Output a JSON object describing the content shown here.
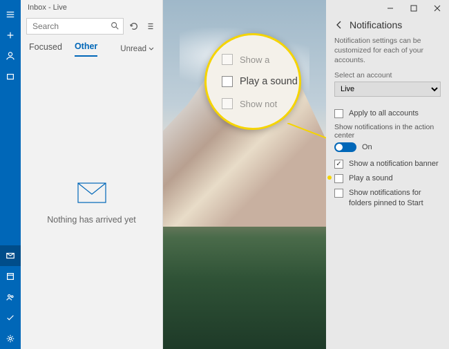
{
  "titlebar": "Inbox - Live",
  "search": {
    "placeholder": "Search"
  },
  "tabs": {
    "focused": "Focused",
    "other": "Other",
    "unread": "Unread"
  },
  "empty_state": "Nothing has arrived yet",
  "lens": {
    "row_top": "Show a",
    "row_main": "Play a sound",
    "row_bottom": "Show not"
  },
  "panel": {
    "title": "Notifications",
    "desc": "Notification settings can be customized for each of your accounts.",
    "select_label": "Select an account",
    "account": "Live",
    "apply_all": "Apply to all accounts",
    "section_action_center": "Show notifications in the action center",
    "toggle_label": "On",
    "opt_banner": "Show a notification banner",
    "opt_sound": "Play a sound",
    "opt_folders": "Show notifications for folders pinned to Start"
  }
}
